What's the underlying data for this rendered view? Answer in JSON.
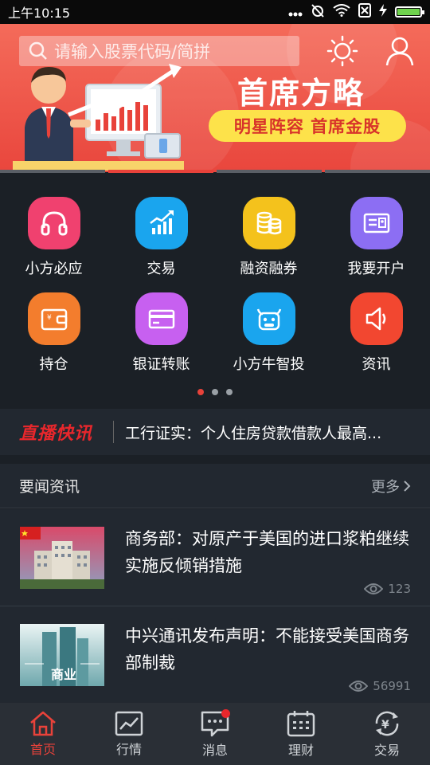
{
  "status_bar": {
    "time": "上午10:15",
    "battery_color": "#6fd34d"
  },
  "header": {
    "search_placeholder": "请输入股票代码/简拼",
    "theme_icon": "sun-icon",
    "profile_icon": "user-icon"
  },
  "banner": {
    "title": "首席方略",
    "subtitle": "明星阵容 首席金股",
    "pill_color": "#fde24a"
  },
  "quick_menu": [
    {
      "label": "小方必应",
      "icon": "headphones-icon",
      "color": "#f0416f"
    },
    {
      "label": "交易",
      "icon": "trend-chart-icon",
      "color": "#1aa5ee"
    },
    {
      "label": "融资融券",
      "icon": "coins-icon",
      "color": "#f4c21c"
    },
    {
      "label": "我要开户",
      "icon": "id-card-icon",
      "color": "#8c6ef3"
    },
    {
      "label": "持仓",
      "icon": "wallet-icon",
      "color": "#f37d2d"
    },
    {
      "label": "银证转账",
      "icon": "bank-card-icon",
      "color": "#c760f0"
    },
    {
      "label": "小方牛智投",
      "icon": "robot-bull-icon",
      "color": "#1aa5ee"
    },
    {
      "label": "资讯",
      "icon": "speaker-icon",
      "color": "#f24730"
    }
  ],
  "live_news": {
    "tag": "直播快讯",
    "headline": "工行证实：个人住房贷款借款人最高..."
  },
  "news_section": {
    "title": "要闻资讯",
    "more_label": "更多"
  },
  "articles": [
    {
      "title": "商务部：对原产于美国的进口浆粕继续实施反倾销措施",
      "views": "123"
    },
    {
      "title": "中兴通讯发布声明：不能接受美国商务部制裁",
      "views": "56991",
      "thumb_caption": "商业"
    }
  ],
  "bottom_nav": [
    {
      "label": "首页",
      "icon": "home-icon",
      "active": true
    },
    {
      "label": "行情",
      "icon": "market-chart-icon",
      "active": false
    },
    {
      "label": "消息",
      "icon": "message-icon",
      "active": false,
      "badge": true
    },
    {
      "label": "理财",
      "icon": "calendar-icon",
      "active": false
    },
    {
      "label": "交易",
      "icon": "yuan-exchange-icon",
      "active": false
    }
  ],
  "accent_color": "#e8423a"
}
